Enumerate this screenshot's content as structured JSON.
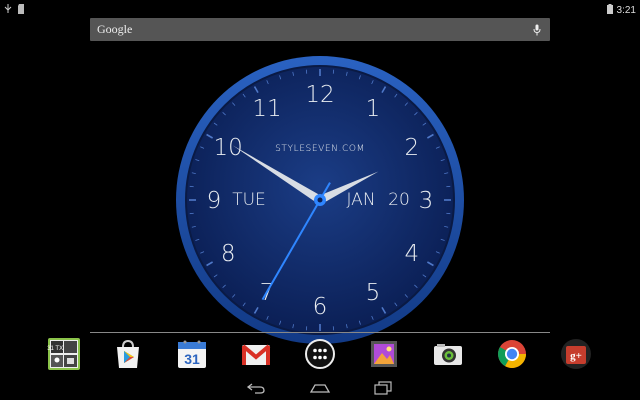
{
  "status_bar": {
    "time": "3:21",
    "left_icons": [
      "usb-icon",
      "sdcard-icon"
    ],
    "right_icons": [
      "battery-icon"
    ]
  },
  "search": {
    "label": "Google",
    "mic_icon": "mic-icon"
  },
  "clock_widget": {
    "brand": "STYLESEVEN.COM",
    "day": "TUE",
    "month": "JAN",
    "date": "20",
    "numbers": [
      "12",
      "1",
      "2",
      "3",
      "4",
      "5",
      "6",
      "7",
      "8",
      "9",
      "10",
      "11"
    ],
    "hour_hand_angle_deg": 64,
    "minute_hand_angle_deg": 302,
    "second_hand_angle_deg": 210,
    "colors": {
      "face": "#102a66",
      "bezel": "#1a4aa0",
      "hands": "#d8dde4",
      "second_hand": "#2f86ff"
    }
  },
  "dock": {
    "apps": [
      {
        "icon": "calendar-widget-icon",
        "label": "31 TXT"
      },
      {
        "icon": "play-store-icon"
      },
      {
        "icon": "calendar-icon",
        "label": "31"
      },
      {
        "icon": "gmail-icon"
      },
      {
        "icon": "all-apps-icon"
      },
      {
        "icon": "gallery-icon"
      },
      {
        "icon": "camera-icon"
      },
      {
        "icon": "chrome-icon"
      },
      {
        "icon": "google-plus-icon",
        "label": "g+"
      }
    ]
  },
  "nav_bar": {
    "buttons": [
      "back-icon",
      "home-icon",
      "recents-icon"
    ]
  }
}
